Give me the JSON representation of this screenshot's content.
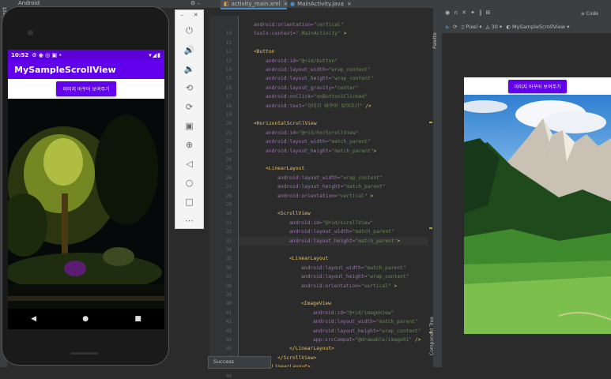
{
  "ide": {
    "project_label": "1: Project",
    "android_dropdown": "Android",
    "tabs": [
      "activity_main.xml",
      "MainActivity.java"
    ],
    "design_mode": "Code",
    "device": "Pixel",
    "api": "30",
    "theme": "MySampleScrollView",
    "palette_label": "Palette",
    "component_tree_label": "Component Tree",
    "toast": "Success"
  },
  "phone": {
    "time": "10:52",
    "app_title": "MySampleScrollView",
    "button_label": "이미지 바꾸어 보여주기"
  },
  "preview": {
    "button_label": "이미지 바꾸어 보여주기"
  },
  "colors": {
    "accent": "#6200ee",
    "status": "#5b00d6"
  },
  "code_lines": [
    {
      "n": "",
      "segs": [
        [
          "attr",
          "android:orientation="
        ],
        [
          "val",
          "\"vertical\""
        ]
      ],
      "indent": 1
    },
    {
      "n": "10",
      "segs": [
        [
          "attr",
          "tools:context="
        ],
        [
          "val",
          "\".MainActivity\""
        ],
        [
          "tag",
          " >"
        ]
      ],
      "indent": 1
    },
    {
      "n": "11",
      "segs": [],
      "indent": 0
    },
    {
      "n": "12",
      "segs": [
        [
          "tag",
          "<Button"
        ]
      ],
      "indent": 1
    },
    {
      "n": "13",
      "segs": [
        [
          "attr",
          "android:id="
        ],
        [
          "val",
          "\"@+id/button\""
        ]
      ],
      "indent": 2
    },
    {
      "n": "14",
      "segs": [
        [
          "attr",
          "android:layout_width="
        ],
        [
          "val",
          "\"wrap_content\""
        ]
      ],
      "indent": 2
    },
    {
      "n": "15",
      "segs": [
        [
          "attr",
          "android:layout_height="
        ],
        [
          "val",
          "\"wrap_content\""
        ]
      ],
      "indent": 2
    },
    {
      "n": "16",
      "segs": [
        [
          "attr",
          "android:layout_gravity="
        ],
        [
          "val",
          "\"center\""
        ]
      ],
      "indent": 2
    },
    {
      "n": "17",
      "segs": [
        [
          "attr",
          "android:onClick="
        ],
        [
          "val",
          "\"onButton1Clicked\""
        ]
      ],
      "indent": 2
    },
    {
      "n": "18",
      "segs": [
        [
          "attr",
          "android:text="
        ],
        [
          "val",
          "\"이미지 바꾸어 보여주기\""
        ],
        [
          "tag",
          " />"
        ]
      ],
      "indent": 2
    },
    {
      "n": "19",
      "segs": [],
      "indent": 0
    },
    {
      "n": "20",
      "segs": [
        [
          "tag",
          "<HorizontalScrollView"
        ]
      ],
      "indent": 1
    },
    {
      "n": "21",
      "segs": [
        [
          "attr",
          "android:id="
        ],
        [
          "val",
          "\"@+id/horScrollView\""
        ]
      ],
      "indent": 2
    },
    {
      "n": "22",
      "segs": [
        [
          "attr",
          "android:layout_width="
        ],
        [
          "val",
          "\"match_parent\""
        ]
      ],
      "indent": 2
    },
    {
      "n": "23",
      "segs": [
        [
          "attr",
          "android:layout_height="
        ],
        [
          "val",
          "\"match_parent\""
        ],
        [
          "tag",
          ">"
        ]
      ],
      "indent": 2
    },
    {
      "n": "24",
      "segs": [],
      "indent": 0
    },
    {
      "n": "25",
      "segs": [
        [
          "tag",
          "<LinearLayout"
        ]
      ],
      "indent": 2
    },
    {
      "n": "26",
      "segs": [
        [
          "attr",
          "android:layout_width="
        ],
        [
          "val",
          "\"wrap_content\""
        ]
      ],
      "indent": 3
    },
    {
      "n": "27",
      "segs": [
        [
          "attr",
          "android:layout_height="
        ],
        [
          "val",
          "\"match_parent\""
        ]
      ],
      "indent": 3
    },
    {
      "n": "28",
      "segs": [
        [
          "attr",
          "android:orientation="
        ],
        [
          "val",
          "\"vertical\""
        ],
        [
          "tag",
          " >"
        ]
      ],
      "indent": 3
    },
    {
      "n": "29",
      "segs": [],
      "indent": 0
    },
    {
      "n": "30",
      "segs": [
        [
          "tag",
          "<ScrollView"
        ]
      ],
      "indent": 3
    },
    {
      "n": "31",
      "segs": [
        [
          "attr",
          "android:id="
        ],
        [
          "val",
          "\"@+id/scrollView\""
        ]
      ],
      "indent": 4
    },
    {
      "n": "32",
      "segs": [
        [
          "attr",
          "android:layout_width="
        ],
        [
          "val",
          "\"match_parent\""
        ]
      ],
      "indent": 4
    },
    {
      "n": "33",
      "segs": [
        [
          "attr",
          "android:layout_height="
        ],
        [
          "val",
          "\"match_parent\""
        ],
        [
          "tag",
          ">"
        ]
      ],
      "indent": 4
    },
    {
      "n": "34",
      "segs": [],
      "indent": 0
    },
    {
      "n": "35",
      "segs": [
        [
          "tag",
          "<LinearLayout"
        ]
      ],
      "indent": 4
    },
    {
      "n": "36",
      "segs": [
        [
          "attr",
          "android:layout_width="
        ],
        [
          "val",
          "\"match_parent\""
        ]
      ],
      "indent": 5
    },
    {
      "n": "37",
      "segs": [
        [
          "attr",
          "android:layout_height="
        ],
        [
          "val",
          "\"wrap_content\""
        ]
      ],
      "indent": 5
    },
    {
      "n": "38",
      "segs": [
        [
          "attr",
          "android:orientation="
        ],
        [
          "val",
          "\"vertical\""
        ],
        [
          "tag",
          " >"
        ]
      ],
      "indent": 5
    },
    {
      "n": "39",
      "segs": [],
      "indent": 0
    },
    {
      "n": "40",
      "segs": [
        [
          "tag",
          "<ImageView"
        ]
      ],
      "indent": 5
    },
    {
      "n": "41",
      "segs": [
        [
          "attr",
          "android:id="
        ],
        [
          "val",
          "\"@+id/imageView\""
        ]
      ],
      "indent": 6
    },
    {
      "n": "42",
      "segs": [
        [
          "attr",
          "android:layout_width="
        ],
        [
          "val",
          "\"match_parent\""
        ]
      ],
      "indent": 6
    },
    {
      "n": "43",
      "segs": [
        [
          "attr",
          "android:layout_height="
        ],
        [
          "val",
          "\"wrap_content\""
        ]
      ],
      "indent": 6
    },
    {
      "n": "44",
      "segs": [
        [
          "attr",
          "app:srcCompat="
        ],
        [
          "val",
          "\"@drawable/image01\""
        ],
        [
          "tag",
          " />"
        ]
      ],
      "indent": 6
    },
    {
      "n": "45",
      "segs": [
        [
          "tag",
          "</LinearLayout>"
        ]
      ],
      "indent": 4
    },
    {
      "n": "46",
      "segs": [
        [
          "tag",
          "</ScrollView>"
        ]
      ],
      "indent": 3
    },
    {
      "n": "47",
      "segs": [
        [
          "tag",
          "</LinearLayout>"
        ]
      ],
      "indent": 2
    },
    {
      "n": "48",
      "segs": [
        [
          "tag",
          "</HorizontalScrollView>"
        ]
      ],
      "indent": 1
    }
  ]
}
